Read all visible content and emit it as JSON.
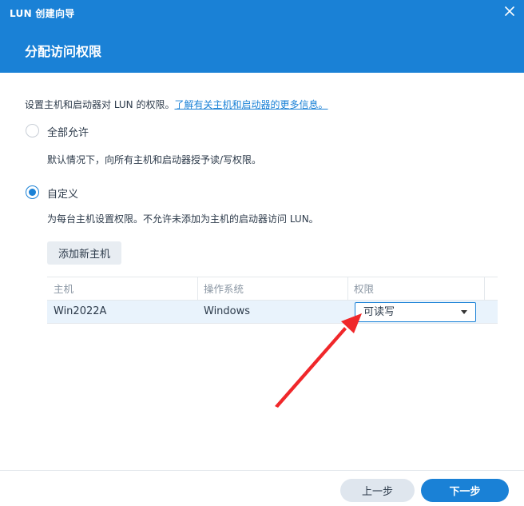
{
  "window": {
    "title": "LUN 创建向导",
    "close_icon": "close-icon"
  },
  "step": {
    "title": "分配访问权限"
  },
  "intro": {
    "text": "设置主机和启动器对 LUN 的权限。",
    "link": "了解有关主机和启动器的更多信息。"
  },
  "options": {
    "all": {
      "label": "全部允许",
      "desc": "默认情况下，向所有主机和启动器授予读/写权限。",
      "checked": false
    },
    "custom": {
      "label": "自定义",
      "desc": "为每台主机设置权限。不允许未添加为主机的启动器访问 LUN。",
      "checked": true
    }
  },
  "add_host_button": "添加新主机",
  "table": {
    "headers": [
      "主机",
      "操作系统",
      "权限"
    ],
    "rows": [
      {
        "host": "Win2022A",
        "os": "Windows",
        "permission": "可读写"
      }
    ]
  },
  "footer": {
    "prev": "上一步",
    "next": "下一步"
  },
  "colors": {
    "accent": "#1a81d6",
    "annotation_arrow": "#f0272a"
  }
}
